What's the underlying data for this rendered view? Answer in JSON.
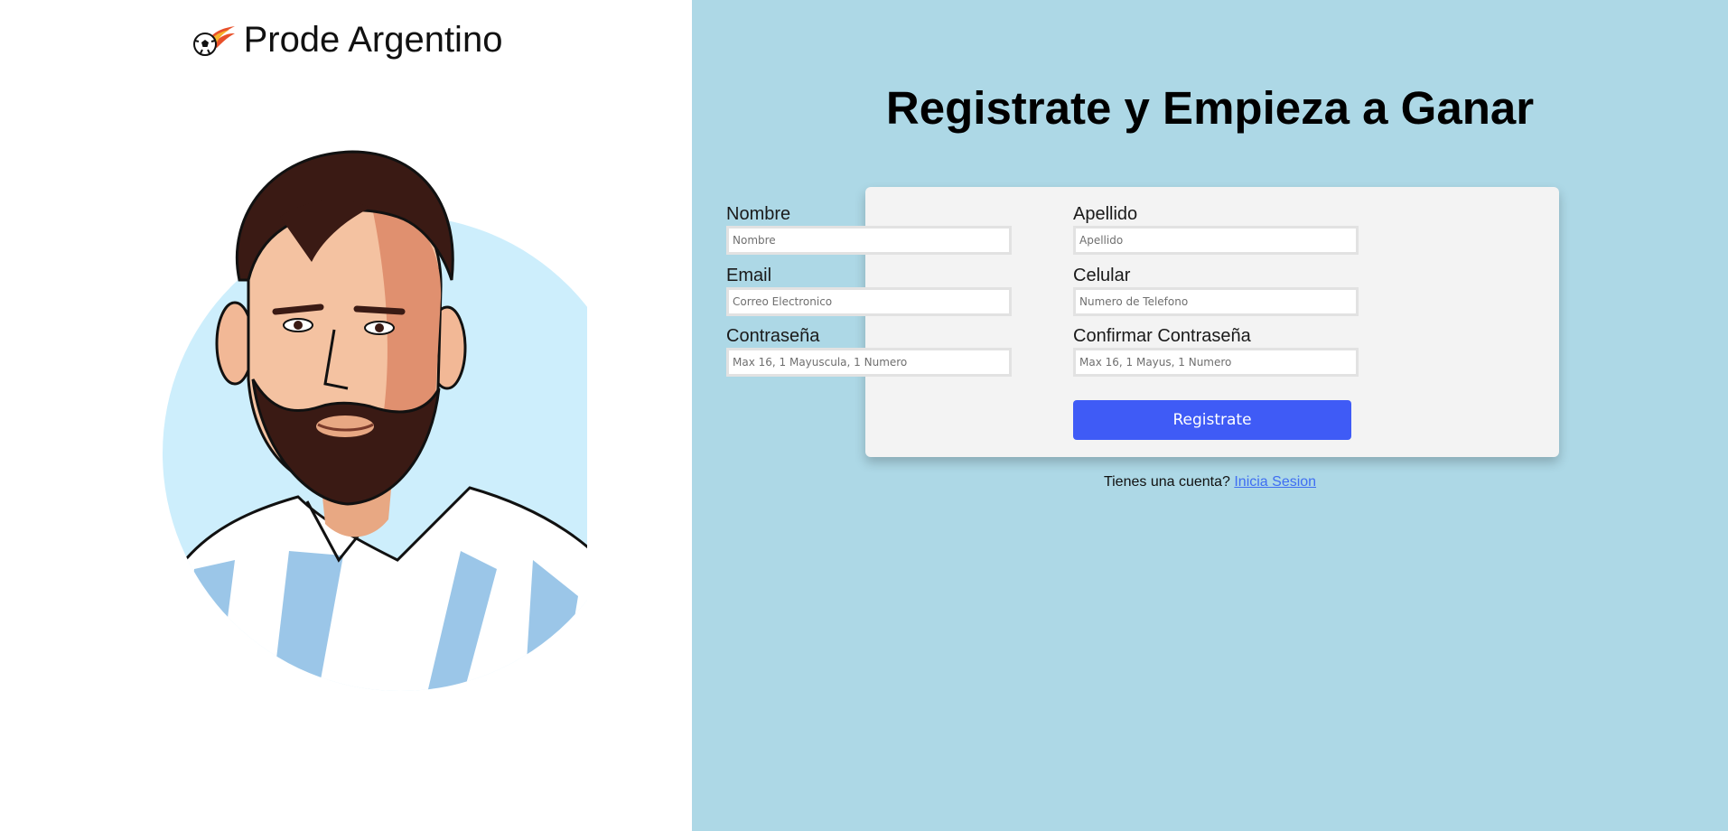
{
  "brand": {
    "title": "Prode Argentino",
    "logo_icon": "flaming-soccer-ball-icon"
  },
  "hero": {
    "illustration": "player-portrait-illustration",
    "jersey_colors": [
      "#9bc6e8",
      "#ffffff"
    ]
  },
  "register": {
    "heading": "Registrate y Empieza a Ganar",
    "fields": {
      "nombre": {
        "label": "Nombre",
        "placeholder": "Nombre",
        "value": ""
      },
      "apellido": {
        "label": "Apellido",
        "placeholder": "Apellido",
        "value": ""
      },
      "email": {
        "label": "Email",
        "placeholder": "Correo Electronico",
        "value": ""
      },
      "celular": {
        "label": "Celular",
        "placeholder": "Numero de Telefono",
        "value": ""
      },
      "password": {
        "label": "Contraseña",
        "placeholder": "Max 16, 1 Mayuscula, 1 Numero",
        "value": ""
      },
      "confirm_password": {
        "label": "Confirmar Contraseña",
        "placeholder": "Max 16, 1 Mayus, 1 Numero",
        "value": ""
      }
    },
    "submit_label": "Registrate",
    "login_prompt": "Tienes una cuenta?",
    "login_link": "Inicia Sesion"
  },
  "colors": {
    "right_panel_bg": "#add8e6",
    "card_bg": "#f3f3f3",
    "button_bg": "#3f5bf6",
    "link": "#3f6ef2",
    "avatar_circle": "#cdeefc"
  }
}
